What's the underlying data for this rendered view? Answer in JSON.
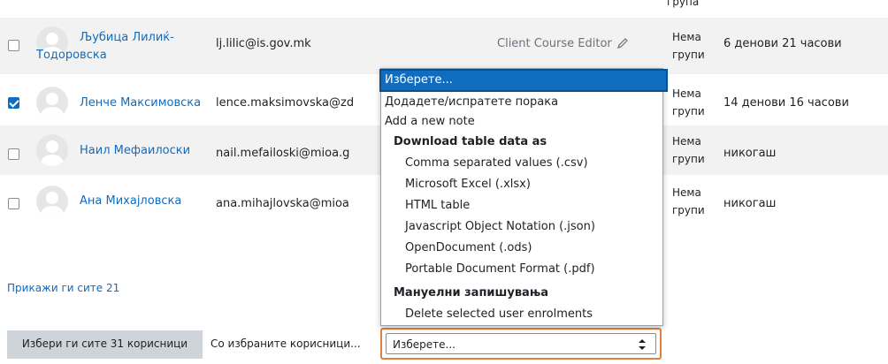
{
  "top_fragment": "група",
  "rows": [
    {
      "name": "Љубица Лилиќ-Тодоровска",
      "name_line1": "Љубица Лилиќ-",
      "name_line2": "Тодоровска",
      "email": "lj.lilic@is.gov.mk",
      "role": "Client Course Editor",
      "groups": "Нема групи",
      "groups_line1": "Нема",
      "groups_line2": "групи",
      "last_access": "6 денови 21 часови",
      "checked": false
    },
    {
      "name": "Ленче Максимовска",
      "email": "lence.maksimovska@zd",
      "groups_line1": "Нема",
      "groups_line2": "групи",
      "last_access": "14 денови 16 часови",
      "checked": true
    },
    {
      "name": "Наил Мефаилоски",
      "email": "nail.mefailoski@mioa.g",
      "groups_line1": "Нема",
      "groups_line2": "групи",
      "last_access": "никогаш",
      "checked": false
    },
    {
      "name": "Ана Михајловска",
      "email": "ana.mihajlovska@mioa",
      "groups_line1": "Нема",
      "groups_line2": "групи",
      "last_access": "никогаш",
      "checked": false
    }
  ],
  "show_all_link": "Прикажи ги сите 21",
  "select_all_button": "Избери ги сите 31 корисници",
  "with_selected_label": "Со избраните корисници...",
  "dropdown": {
    "selected_value": "Изберете...",
    "options": [
      {
        "label": "Изберете...",
        "type": "option",
        "selected": true
      },
      {
        "label": "Додадете/испратете порака",
        "type": "option"
      },
      {
        "label": "Add a new note",
        "type": "option"
      },
      {
        "label": "Download table data as",
        "type": "group"
      },
      {
        "label": "Comma separated values (.csv)",
        "type": "suboption"
      },
      {
        "label": "Microsoft Excel (.xlsx)",
        "type": "suboption"
      },
      {
        "label": "HTML table",
        "type": "suboption"
      },
      {
        "label": "Javascript Object Notation (.json)",
        "type": "suboption"
      },
      {
        "label": "OpenDocument (.ods)",
        "type": "suboption"
      },
      {
        "label": "Portable Document Format (.pdf)",
        "type": "suboption"
      },
      {
        "label": "Мануелни запишувања",
        "type": "group"
      },
      {
        "label": "Delete selected user enrolments",
        "type": "suboption"
      }
    ]
  },
  "colors": {
    "link": "#0f6cbf",
    "highlight": "#e08040",
    "row_shade": "#f2f2f2"
  },
  "icons": {
    "edit": "pencil-icon",
    "avatar": "user-avatar-icon",
    "select_arrows": "updown-arrows-icon"
  }
}
